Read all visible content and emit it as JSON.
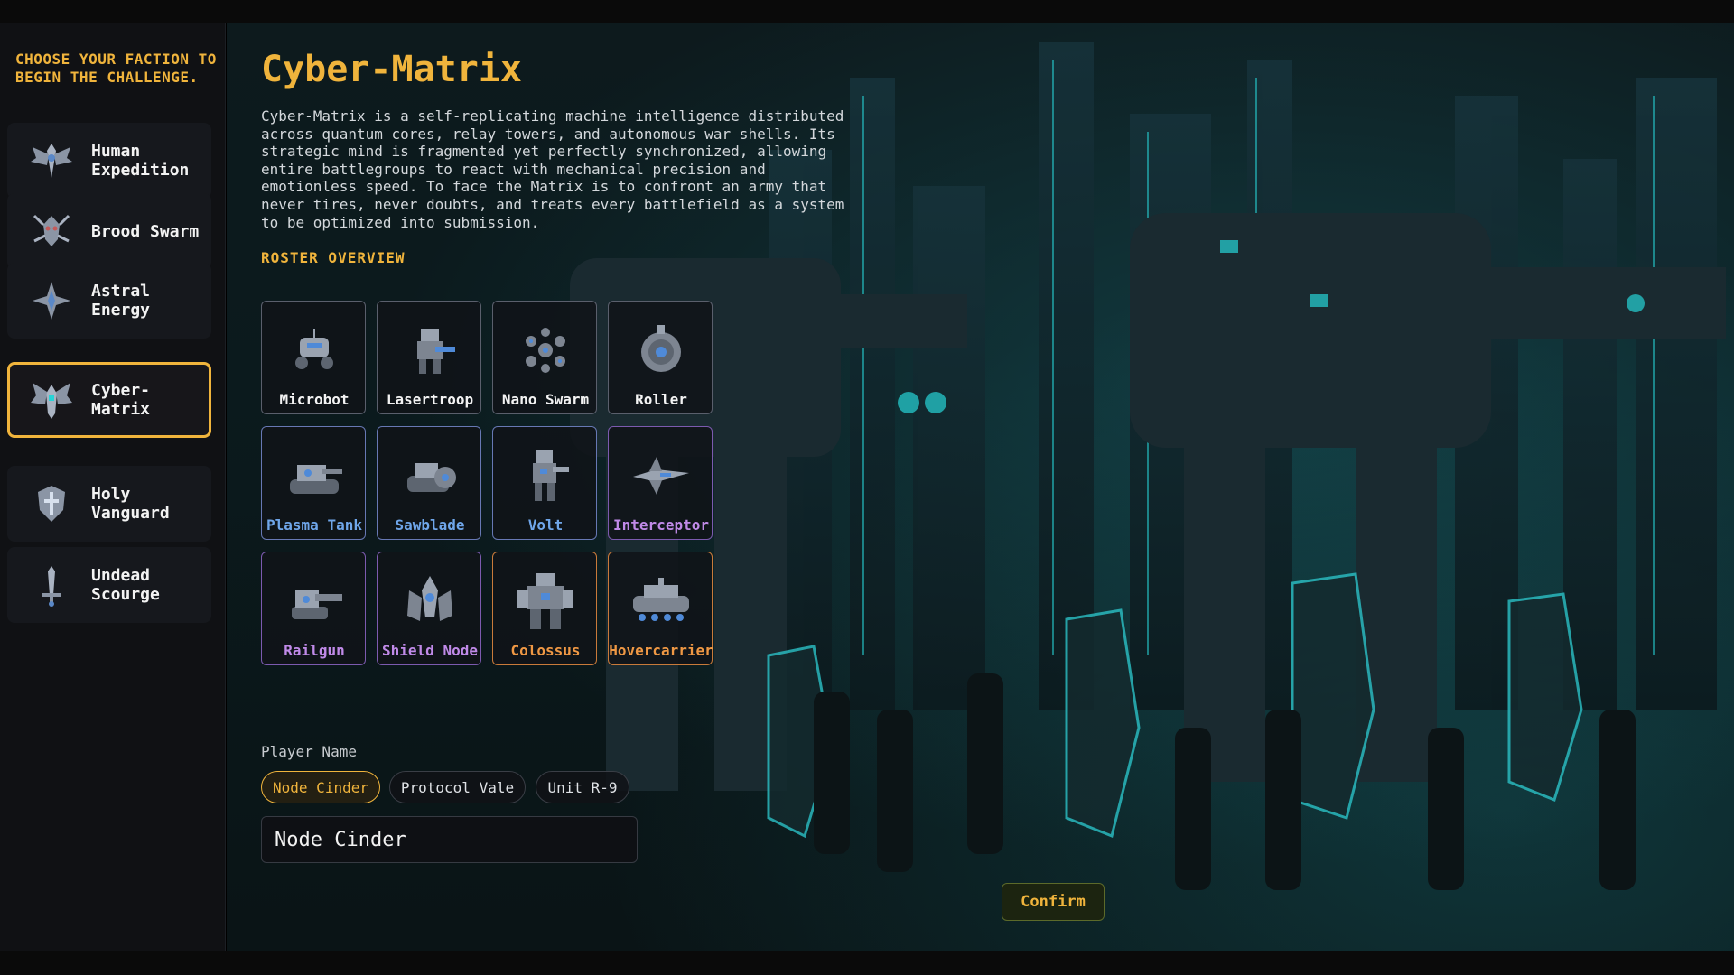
{
  "sidebar": {
    "prompt": "CHOOSE YOUR FACTION TO BEGIN THE CHALLENGE.",
    "factions": [
      {
        "label": "Human Expedition",
        "icon": "winged-shield-icon",
        "selected": false
      },
      {
        "label": "Brood Swarm",
        "icon": "insect-skull-icon",
        "selected": false
      },
      {
        "label": "Astral Energy",
        "icon": "crystal-star-icon",
        "selected": false
      },
      {
        "label": "Cyber-Matrix",
        "icon": "mech-wing-icon",
        "selected": true
      },
      {
        "label": "Holy Vanguard",
        "icon": "holy-shield-icon",
        "selected": false
      },
      {
        "label": "Undead Scourge",
        "icon": "bone-sword-icon",
        "selected": false
      }
    ]
  },
  "main": {
    "title": "Cyber-Matrix",
    "description": "Cyber-Matrix is a self-replicating machine intelligence distributed across quantum cores, relay towers, and autonomous war shells. Its strategic mind is fragmented yet perfectly synchronized, allowing entire battlegroups to react with mechanical precision and emotionless speed. To face the Matrix is to confront an army that never tires, never doubts, and treats every battlefield as a system to be optimized into submission.",
    "roster_heading": "ROSTER OVERVIEW",
    "roster": [
      {
        "name": "Microbot",
        "tier": "common",
        "icon": "microbot-icon"
      },
      {
        "name": "Lasertroop",
        "tier": "common",
        "icon": "lasertroop-icon"
      },
      {
        "name": "Nano Swarm",
        "tier": "common",
        "icon": "nano-swarm-icon"
      },
      {
        "name": "Roller",
        "tier": "common",
        "icon": "roller-icon"
      },
      {
        "name": "Plasma Tank",
        "tier": "rare",
        "icon": "plasma-tank-icon"
      },
      {
        "name": "Sawblade",
        "tier": "rare",
        "icon": "sawblade-icon"
      },
      {
        "name": "Volt",
        "tier": "rare",
        "icon": "volt-icon"
      },
      {
        "name": "Interceptor",
        "tier": "epic",
        "icon": "interceptor-icon"
      },
      {
        "name": "Railgun",
        "tier": "epic",
        "icon": "railgun-icon"
      },
      {
        "name": "Shield Node",
        "tier": "epic",
        "icon": "shield-node-icon"
      },
      {
        "name": "Colossus",
        "tier": "legendary",
        "icon": "colossus-icon"
      },
      {
        "name": "Hovercarrier",
        "tier": "legendary",
        "icon": "hovercarrier-icon"
      }
    ],
    "tier_colors": {
      "common": "#f3f3f3",
      "rare": "#6fa6ea",
      "epic": "#c08ae8",
      "legendary": "#ef9844"
    },
    "player": {
      "label": "Player Name",
      "suggestions": [
        "Node Cinder",
        "Protocol Vale",
        "Unit R-9"
      ],
      "selected_suggestion": "Node Cinder",
      "value": "Node Cinder"
    },
    "confirm_label": "Confirm"
  },
  "colors": {
    "accent": "#f0b43c",
    "background_tint": "#0b1a1d",
    "glow": "#27d3d6"
  }
}
